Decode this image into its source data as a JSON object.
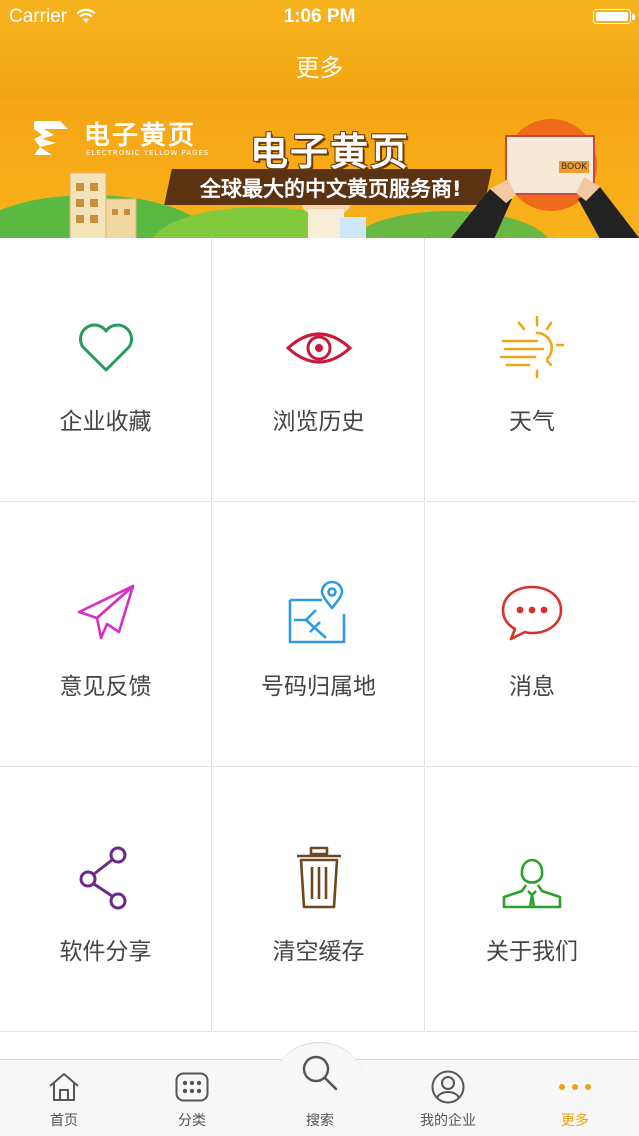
{
  "status_bar": {
    "carrier": "Carrier",
    "time": "1:06 PM"
  },
  "nav": {
    "title": "更多"
  },
  "banner": {
    "logo_text": "电子黄页",
    "logo_subtitle": "ELECTRONIC YELLOW PAGES",
    "headline": "电子黄页",
    "slogan": "全球最大的中文黄页服务商!",
    "book_label": "BOOK"
  },
  "grid": {
    "items": [
      {
        "label": "企业收藏",
        "icon": "heart-icon",
        "color": "#2a9a5a"
      },
      {
        "label": "浏览历史",
        "icon": "eye-icon",
        "color": "#c8193c"
      },
      {
        "label": "天气",
        "icon": "weather-icon",
        "color": "#f2a515"
      },
      {
        "label": "意见反馈",
        "icon": "paper-plane-icon",
        "color": "#d52fc9"
      },
      {
        "label": "号码归属地",
        "icon": "map-pin-icon",
        "color": "#2e9be0"
      },
      {
        "label": "消息",
        "icon": "chat-bubble-icon",
        "color": "#d6322a"
      },
      {
        "label": "软件分享",
        "icon": "share-icon",
        "color": "#6b2a8a"
      },
      {
        "label": "清空缓存",
        "icon": "trash-icon",
        "color": "#6b4a23"
      },
      {
        "label": "关于我们",
        "icon": "person-icon",
        "color": "#2aa12a"
      }
    ]
  },
  "tabbar": {
    "tabs": [
      {
        "label": "首页",
        "icon": "home-icon"
      },
      {
        "label": "分类",
        "icon": "grid-dots-icon"
      },
      {
        "label": "搜索",
        "icon": "search-icon"
      },
      {
        "label": "我的企业",
        "icon": "user-circle-icon"
      },
      {
        "label": "更多",
        "icon": "more-dots-icon",
        "active": true
      }
    ],
    "accent_color": "#f0a10e"
  }
}
